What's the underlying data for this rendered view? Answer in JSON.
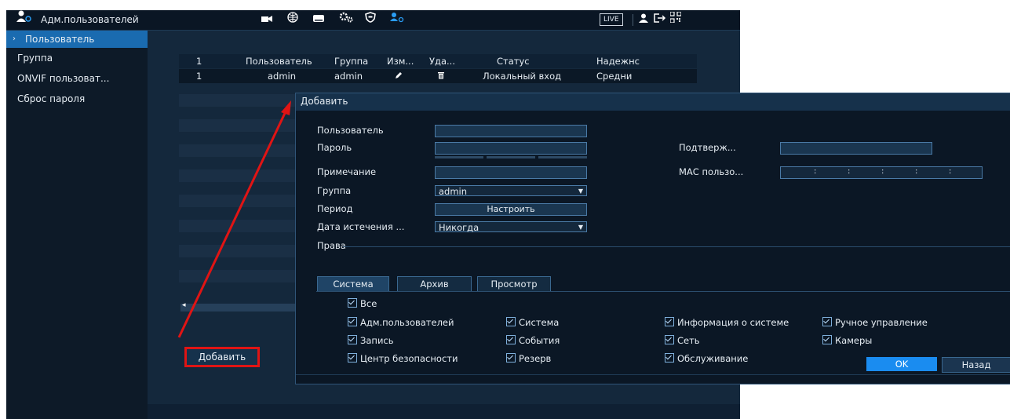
{
  "app": {
    "title": "Адм.пользователей",
    "status_badge": "LIVE",
    "topbar_icons": [
      "user-admin-icon",
      "camera-icon",
      "network-icon",
      "storage-icon",
      "settings-icon",
      "security-icon",
      "account-icon",
      "user-icon",
      "logout-icon",
      "qr-icon"
    ]
  },
  "sidebar": {
    "items": [
      {
        "label": "Пользователь",
        "active": true
      },
      {
        "label": "Группа"
      },
      {
        "label": "ONVIF пользоват..."
      },
      {
        "label": "Сброс пароля"
      }
    ]
  },
  "table": {
    "headers": [
      "1",
      "Пользователь",
      "Группа",
      "Изм...",
      "Уда...",
      "Статус",
      "Надежнс"
    ],
    "rows": [
      {
        "num": "1",
        "user": "admin",
        "group": "admin",
        "status": "Локальный вход",
        "strength": "Средни"
      }
    ]
  },
  "add_button_label": "Добавить",
  "dialog": {
    "title": "Добавить",
    "labels": {
      "user": "Пользователь",
      "password": "Пароль",
      "confirm": "Подтверж...",
      "note": "Примечание",
      "mac": "МАС пользо...",
      "group": "Группа",
      "period": "Период",
      "expiry": "Дата истечения ...",
      "rights": "Права"
    },
    "group_value": "admin",
    "period_button": "Настроить",
    "expiry_value": "Никогда",
    "tabs": [
      "Система",
      "Архив",
      "Просмотр"
    ],
    "perm_all": "Все",
    "perms": [
      "Адм.пользователей",
      "Система",
      "Информация о системе",
      "Ручное управление",
      "Запись",
      "События",
      "Сеть",
      "Камеры",
      "Центр безопасности",
      "Резерв",
      "Обслуживание"
    ],
    "ok": "OK",
    "back": "Назад"
  },
  "colors": {
    "accent": "#1a8cf0",
    "annotation_red": "#e01414"
  }
}
